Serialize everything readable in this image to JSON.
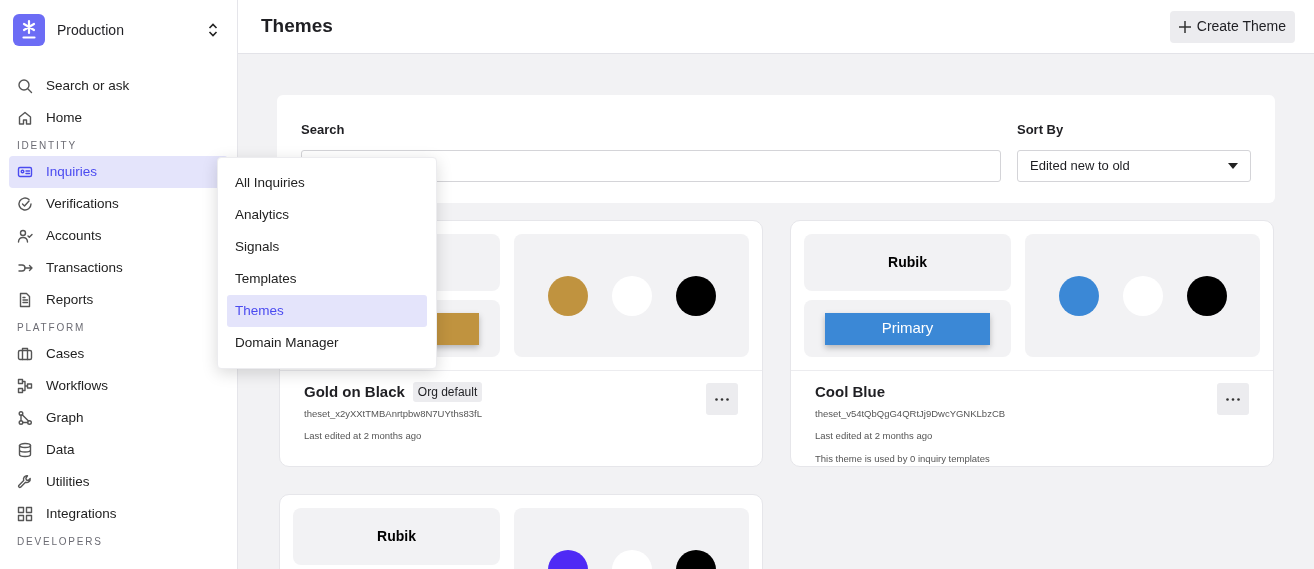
{
  "workspace": {
    "name": "Production"
  },
  "sidebar": {
    "sections": [
      {
        "items": [
          {
            "label": "Search or ask",
            "selected": false
          },
          {
            "label": "Home",
            "selected": false
          }
        ]
      },
      {
        "label": "IDENTITY",
        "items": [
          {
            "label": "Inquiries",
            "selected": true
          },
          {
            "label": "Verifications",
            "selected": false
          },
          {
            "label": "Accounts",
            "selected": false
          },
          {
            "label": "Transactions",
            "selected": false
          },
          {
            "label": "Reports",
            "selected": false
          }
        ]
      },
      {
        "label": "PLATFORM",
        "items": [
          {
            "label": "Cases",
            "selected": false
          },
          {
            "label": "Workflows",
            "selected": false
          },
          {
            "label": "Graph",
            "selected": false
          },
          {
            "label": "Data",
            "selected": false
          },
          {
            "label": "Utilities",
            "selected": false
          },
          {
            "label": "Integrations",
            "selected": false
          }
        ]
      },
      {
        "label": "DEVELOPERS"
      }
    ]
  },
  "submenu": {
    "items": [
      {
        "label": "All Inquiries",
        "selected": false
      },
      {
        "label": "Analytics",
        "selected": false
      },
      {
        "label": "Signals",
        "selected": false
      },
      {
        "label": "Templates",
        "selected": false
      },
      {
        "label": "Themes",
        "selected": true
      },
      {
        "label": "Domain Manager",
        "selected": false
      }
    ]
  },
  "header": {
    "title": "Themes",
    "create_button": "Create Theme"
  },
  "filters": {
    "search_label": "Search",
    "sort_label": "Sort By",
    "sort_value": "Edited new to old"
  },
  "themes": [
    {
      "swatches": [
        {
          "color": "#c0933f"
        },
        {
          "color": "#ffffff"
        },
        {
          "color": "#000000"
        }
      ],
      "name": "Gold on Black",
      "badge": "Org default",
      "id": "theset_x2yXXtTMBAnrtpbw8N7UYths83fL",
      "edited": "Last edited at 2 months ago"
    },
    {
      "font": "Rubik",
      "button_label": "Primary",
      "swatches": [
        {
          "color": "#3b88d6"
        },
        {
          "color": "#ffffff"
        },
        {
          "color": "#000000"
        }
      ],
      "name": "Cool Blue",
      "id": "theset_v54tQbQgG4QRtJj9DwcYGNKLbzCB",
      "edited": "Last edited at 2 months ago",
      "usage": "This theme is used by 0 inquiry templates"
    },
    {
      "font": "Rubik",
      "swatches": [
        {
          "color": "#4f2af5"
        },
        {
          "color": "#ffffff"
        },
        {
          "color": "#000000"
        }
      ]
    }
  ]
}
